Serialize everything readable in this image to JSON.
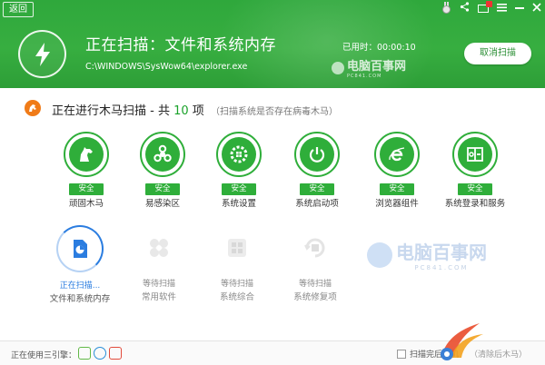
{
  "header": {
    "back_label": "返回",
    "title": "正在扫描：文件和系统内存",
    "path": "C:\\WINDOWS\\SysWow64\\explorer.exe",
    "elapsed_label": "已用时：",
    "elapsed_value": "00:00:10",
    "cancel_label": "取消扫描",
    "logo_text": "电脑百事网",
    "logo_sub": "PC841.COM",
    "controls": [
      "medal-icon",
      "share-icon",
      "mail-icon",
      "menu-icon",
      "minimize-icon",
      "close-icon"
    ]
  },
  "section": {
    "title_prefix": "正在进行木马扫描 - 共",
    "count": "10",
    "title_suffix": "项",
    "hint": "（扫描系统是否存在病毒木马）"
  },
  "items": [
    {
      "label": "顽固木马",
      "status": "安全",
      "icon": "horse-icon"
    },
    {
      "label": "易感染区",
      "status": "安全",
      "icon": "biohazard-icon"
    },
    {
      "label": "系统设置",
      "status": "安全",
      "icon": "windows-gear-icon"
    },
    {
      "label": "系统启动项",
      "status": "安全",
      "icon": "power-icon"
    },
    {
      "label": "浏览器组件",
      "status": "安全",
      "icon": "browser-icon"
    },
    {
      "label": "系统登录和服务",
      "status": "安全",
      "icon": "login-service-icon"
    },
    {
      "label": "文件和系统内存",
      "status": "正在扫描...",
      "icon": "file-memory-icon"
    },
    {
      "label": "常用软件",
      "status": "等待扫描",
      "icon": "software-icon"
    },
    {
      "label": "系统综合",
      "status": "等待扫描",
      "icon": "windows-icon"
    },
    {
      "label": "系统修复项",
      "status": "等待扫描",
      "icon": "repair-icon"
    }
  ],
  "watermark": {
    "text": "电脑百事网",
    "sub": "PC841.COM"
  },
  "footer": {
    "engine_label": "正在使用三引擎：",
    "shutdown_label": "扫描完后关机",
    "shutdown_note": "（清除后木马）"
  },
  "colors": {
    "brand_green": "#2fae3a",
    "scan_blue": "#2b7de0",
    "orange": "#f07b18"
  }
}
